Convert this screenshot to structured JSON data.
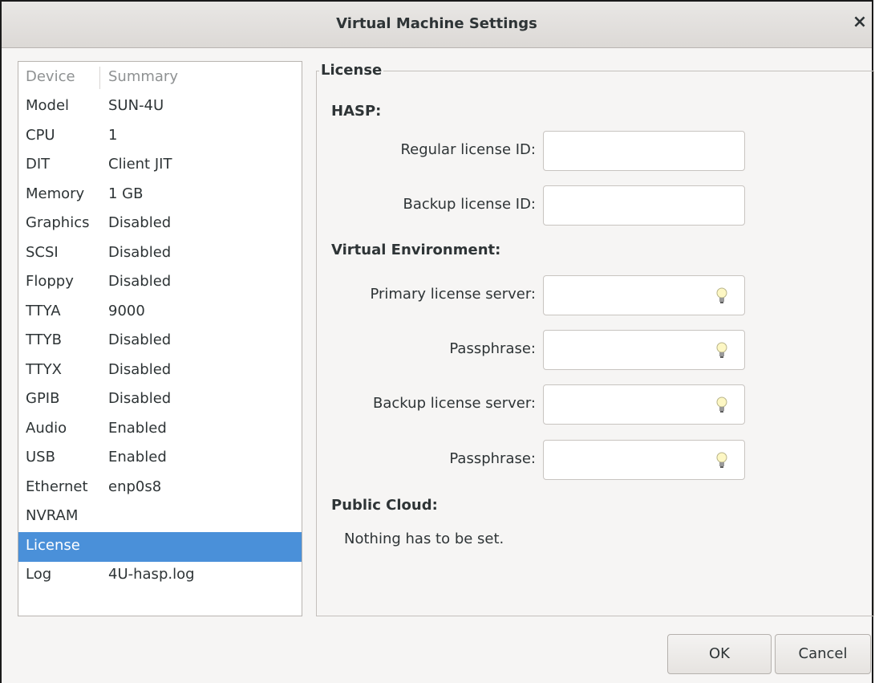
{
  "window": {
    "title": "Virtual Machine Settings",
    "close_glyph": "×"
  },
  "device_list": {
    "columns": [
      "Device",
      "Summary"
    ],
    "rows": [
      {
        "device": "Model",
        "summary": "SUN-4U"
      },
      {
        "device": "CPU",
        "summary": "1"
      },
      {
        "device": "DIT",
        "summary": "Client JIT"
      },
      {
        "device": "Memory",
        "summary": "1 GB"
      },
      {
        "device": "Graphics",
        "summary": "Disabled"
      },
      {
        "device": "SCSI",
        "summary": "Disabled"
      },
      {
        "device": "Floppy",
        "summary": "Disabled"
      },
      {
        "device": "TTYA",
        "summary": "9000"
      },
      {
        "device": "TTYB",
        "summary": "Disabled"
      },
      {
        "device": "TTYX",
        "summary": "Disabled"
      },
      {
        "device": "GPIB",
        "summary": "Disabled"
      },
      {
        "device": "Audio",
        "summary": "Enabled"
      },
      {
        "device": "USB",
        "summary": "Enabled"
      },
      {
        "device": "Ethernet",
        "summary": "enp0s8"
      },
      {
        "device": "NVRAM",
        "summary": ""
      },
      {
        "device": "License",
        "summary": ""
      },
      {
        "device": "Log",
        "summary": "4U-hasp.log"
      }
    ],
    "selected": "License",
    "selection_color": "#4a90d9"
  },
  "license": {
    "frame_title": "License",
    "hasp": {
      "heading": "HASP:",
      "regular_label": "Regular license ID:",
      "regular_value": "",
      "backup_label": "Backup license ID:",
      "backup_value": ""
    },
    "virtual_env": {
      "heading": "Virtual Environment:",
      "primary_server_label": "Primary license server:",
      "primary_server_value": "",
      "primary_pass_label": "Passphrase:",
      "primary_pass_value": "",
      "backup_server_label": "Backup license server:",
      "backup_server_value": "",
      "backup_pass_label": "Passphrase:",
      "backup_pass_value": "",
      "hint_icon": "lightbulb-icon"
    },
    "public_cloud": {
      "heading": "Public Cloud:",
      "note": "Nothing has to be set."
    }
  },
  "buttons": {
    "ok": "OK",
    "cancel": "Cancel"
  }
}
